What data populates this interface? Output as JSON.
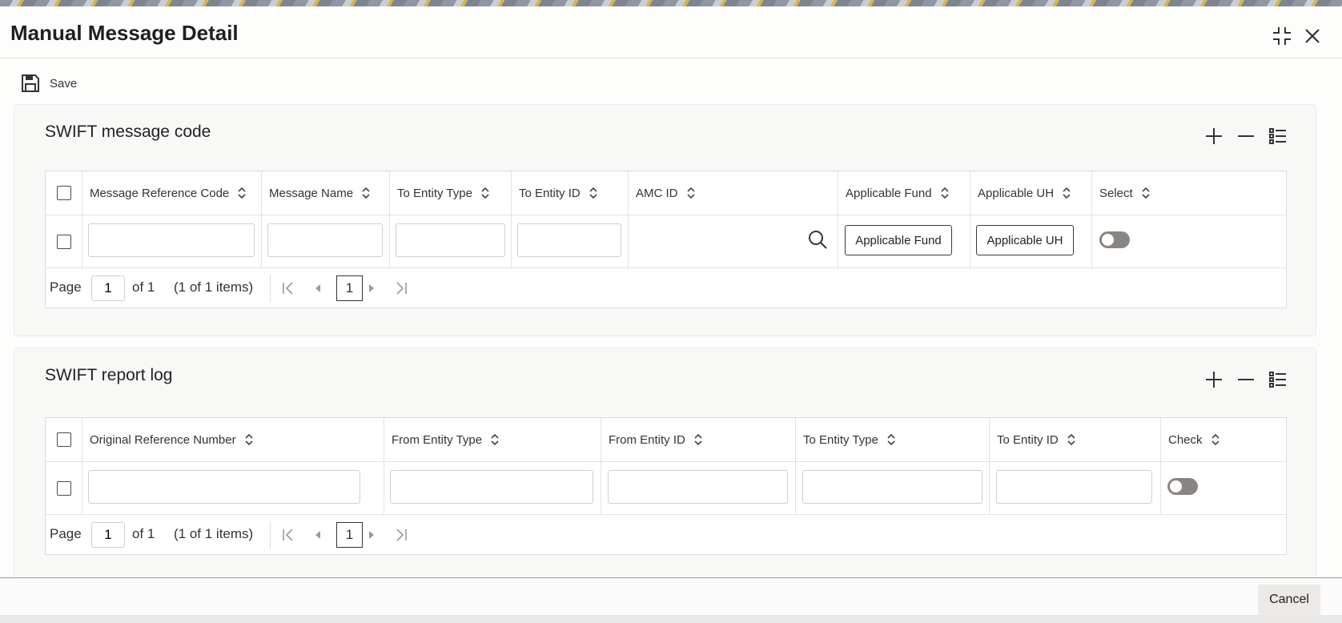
{
  "dialog": {
    "title": "Manual Message Detail"
  },
  "toolbar": {
    "save_label": "Save",
    "save_icon": "floppy-disk-icon"
  },
  "section1": {
    "title": "SWIFT message code",
    "columns": [
      "Message Reference Code",
      "Message Name",
      "To Entity Type",
      "To Entity ID",
      "AMC ID",
      "Applicable Fund",
      "Applicable UH",
      "Select"
    ],
    "row": {
      "message_reference_code": "",
      "message_name": "",
      "to_entity_type": "",
      "to_entity_id": "",
      "amc_id": "",
      "applicable_fund_button": "Applicable Fund",
      "applicable_uh_button": "Applicable UH",
      "select_on": false
    },
    "pager": {
      "page_label": "Page",
      "page_value": "1",
      "of_label": "of 1",
      "items_label": "(1 of 1 items)",
      "current_page": "1"
    }
  },
  "section2": {
    "title": "SWIFT report log",
    "columns": [
      "Original Reference Number",
      "From Entity Type",
      "From Entity ID",
      "To Entity Type",
      "To Entity ID",
      "Check"
    ],
    "row": {
      "original_reference_number": "",
      "from_entity_type": "",
      "from_entity_id": "",
      "to_entity_type": "",
      "to_entity_id": "",
      "check_on": false
    },
    "pager": {
      "page_label": "Page",
      "page_value": "1",
      "of_label": "of 1",
      "items_label": "(1 of 1 items)",
      "current_page": "1"
    }
  },
  "footer": {
    "cancel_label": "Cancel"
  }
}
